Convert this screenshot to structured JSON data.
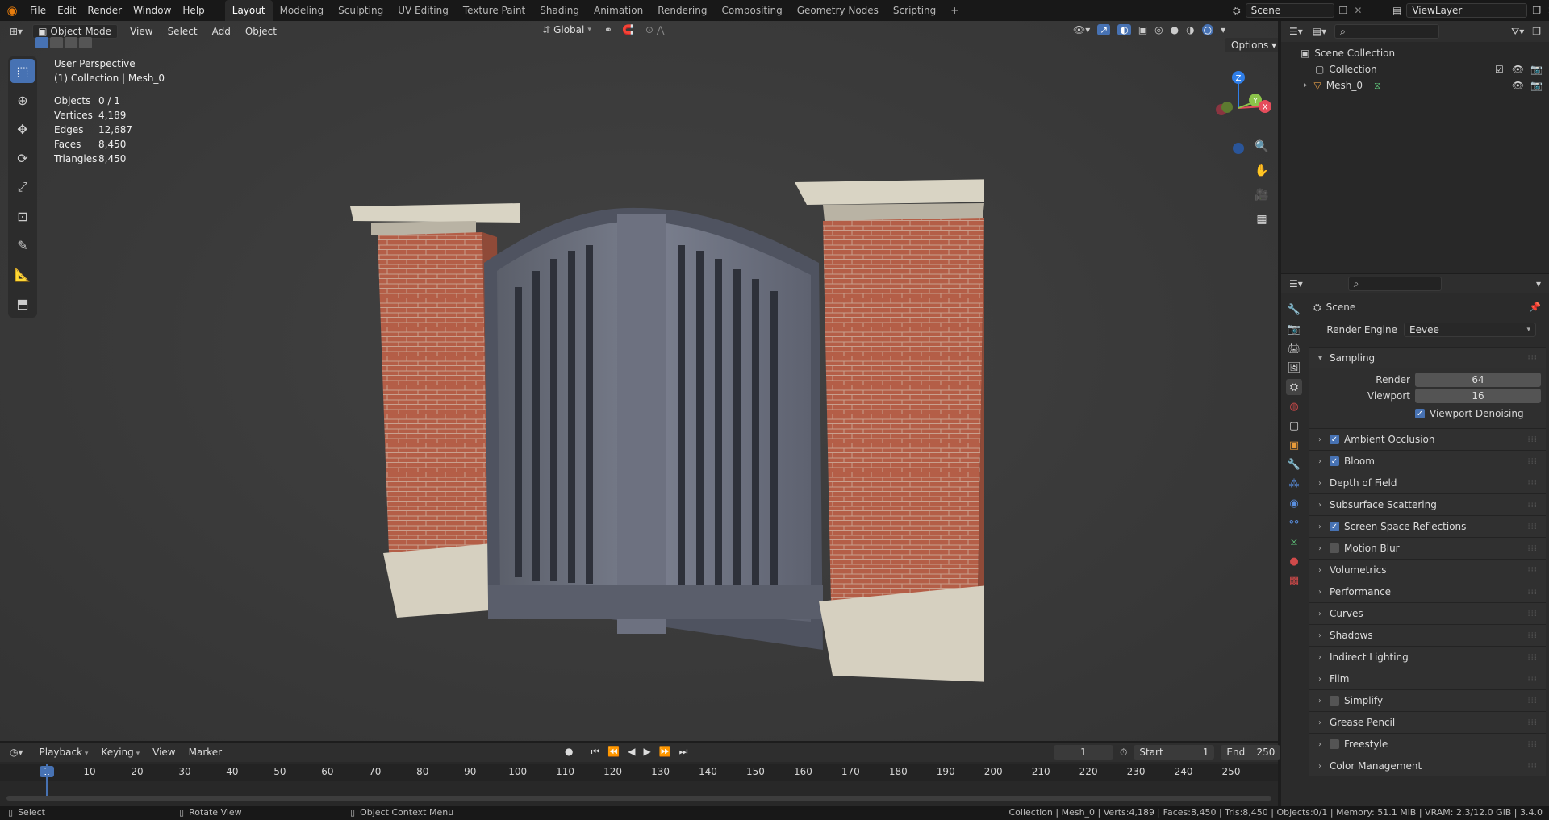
{
  "topbar": {
    "menus": [
      "File",
      "Edit",
      "Render",
      "Window",
      "Help"
    ],
    "workspaces": [
      "Layout",
      "Modeling",
      "Sculpting",
      "UV Editing",
      "Texture Paint",
      "Shading",
      "Animation",
      "Rendering",
      "Compositing",
      "Geometry Nodes",
      "Scripting"
    ],
    "active_workspace": "Layout",
    "add_workspace": "+",
    "scene": "Scene",
    "view_layer": "ViewLayer"
  },
  "viewport_header": {
    "mode": "Object Mode",
    "menus": [
      "View",
      "Select",
      "Add",
      "Object"
    ],
    "orientation": "Global",
    "options": "Options"
  },
  "overlay": {
    "perspective": "User Perspective",
    "collection_line": "(1) Collection | Mesh_0",
    "stats": [
      {
        "label": "Objects",
        "value": "0 / 1"
      },
      {
        "label": "Vertices",
        "value": "4,189"
      },
      {
        "label": "Edges",
        "value": "12,687"
      },
      {
        "label": "Faces",
        "value": "8,450"
      },
      {
        "label": "Triangles",
        "value": "8,450"
      }
    ]
  },
  "gizmo": {
    "z": "Z",
    "y": "Y",
    "x": "X"
  },
  "outliner": {
    "root": "Scene Collection",
    "collection": "Collection",
    "object": "Mesh_0"
  },
  "properties": {
    "context": "Scene",
    "render_engine_label": "Render Engine",
    "render_engine": "Eevee",
    "sampling": {
      "title": "Sampling",
      "render_label": "Render",
      "render_value": "64",
      "viewport_label": "Viewport",
      "viewport_value": "16",
      "denoise_label": "Viewport Denoising"
    },
    "panels": [
      {
        "label": "Ambient Occlusion",
        "checkbox": true,
        "checked": true
      },
      {
        "label": "Bloom",
        "checkbox": true,
        "checked": true
      },
      {
        "label": "Depth of Field",
        "checkbox": false
      },
      {
        "label": "Subsurface Scattering",
        "checkbox": false
      },
      {
        "label": "Screen Space Reflections",
        "checkbox": true,
        "checked": true
      },
      {
        "label": "Motion Blur",
        "checkbox": true,
        "checked": false
      },
      {
        "label": "Volumetrics",
        "checkbox": false
      },
      {
        "label": "Performance",
        "checkbox": false
      },
      {
        "label": "Curves",
        "checkbox": false
      },
      {
        "label": "Shadows",
        "checkbox": false
      },
      {
        "label": "Indirect Lighting",
        "checkbox": false
      },
      {
        "label": "Film",
        "checkbox": false
      },
      {
        "label": "Simplify",
        "checkbox": true,
        "checked": false
      },
      {
        "label": "Grease Pencil",
        "checkbox": false
      },
      {
        "label": "Freestyle",
        "checkbox": true,
        "checked": false
      },
      {
        "label": "Color Management",
        "checkbox": false
      }
    ]
  },
  "timeline": {
    "menus": [
      "Playback",
      "Keying",
      "View",
      "Marker"
    ],
    "current_frame": "1",
    "start_label": "Start",
    "start": "1",
    "end_label": "End",
    "end": "250",
    "ticks": [
      "1",
      "10",
      "20",
      "30",
      "40",
      "50",
      "60",
      "70",
      "80",
      "90",
      "100",
      "110",
      "120",
      "130",
      "140",
      "150",
      "160",
      "170",
      "180",
      "190",
      "200",
      "210",
      "220",
      "230",
      "240",
      "250"
    ]
  },
  "statusbar": {
    "select": "Select",
    "rotate": "Rotate View",
    "context_menu": "Object Context Menu",
    "info": "Collection | Mesh_0 | Verts:4,189 | Faces:8,450 | Tris:8,450 | Objects:0/1 | Memory: 51.1 MiB | VRAM: 2.3/12.0 GiB | 3.4.0"
  },
  "colors": {
    "accent": "#4772b3",
    "brick": "#b0604a",
    "stone": "#d8d2c2",
    "metal": "#6a6f7d"
  }
}
